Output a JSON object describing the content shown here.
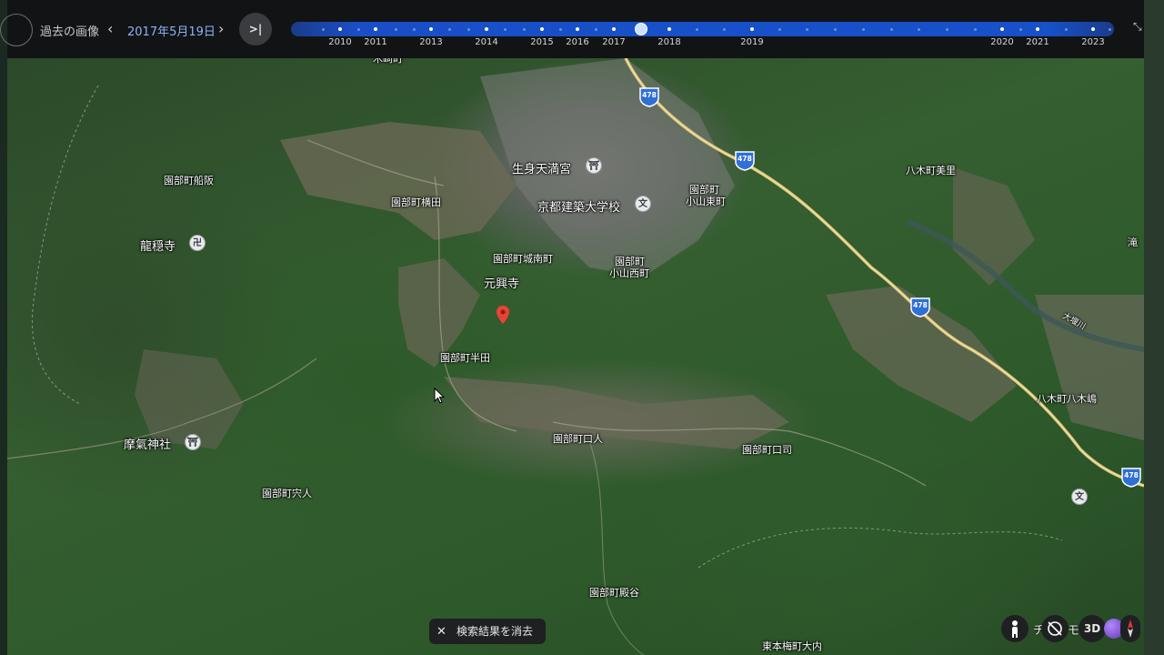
{
  "header": {
    "history_label": "過去の画像",
    "current_date": "2017年5月19日",
    "prev_icon": "chevron-left-icon",
    "next_icon": "chevron-right-icon",
    "latest_button": ">|"
  },
  "timeline": {
    "years": [
      "2010",
      "2011",
      "2013",
      "2014",
      "2015",
      "2016",
      "2017",
      "2018",
      "2019",
      "2020",
      "2021",
      "2023"
    ],
    "selected_date": "2017年5月19日",
    "accent_color": "#1a56db"
  },
  "map": {
    "places": {
      "p1": "園部町船阪",
      "p2": "龍穏寺",
      "p3": "園部町横田",
      "p4": "生身天満宮",
      "p5": "京都建築大学校",
      "p6": "園部町",
      "p7": "小山東町",
      "p8": "八木町美里",
      "p9": "園部町城南町",
      "p10": "園部町",
      "p11": "小山西町",
      "p12": "元興寺",
      "p13": "園部町半田",
      "p14": "八木町八木嶋",
      "p15": "摩氣神社",
      "p16": "園部町口人",
      "p17": "園部町口司",
      "p18": "園部町宍人",
      "p19": "園部町殿谷",
      "p20": "東本梅町大内",
      "p21": "滝",
      "p22": "大堰川",
      "p23": "木崎町"
    },
    "route_number": "478",
    "poi_shrine_glyph": "⛩",
    "poi_temple_glyph": "卍",
    "poi_school_glyph": "文"
  },
  "controls": {
    "clear_search": "検索結果を消去",
    "close_icon": "close-icon",
    "view_3d": "3D",
    "partial_text": "チ",
    "partial_text2": "モ"
  }
}
